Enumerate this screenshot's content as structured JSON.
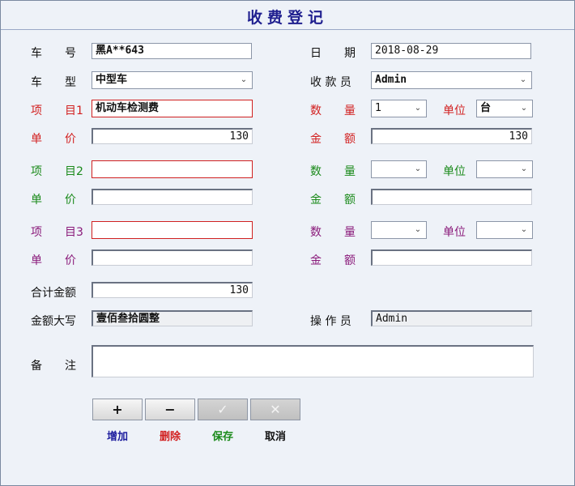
{
  "title": "收费登记",
  "labels": {
    "plate": "车　　号",
    "date": "日　　期",
    "vehicle_type": "车　　型",
    "cashier": "收 款 员",
    "item1": "项　　目1",
    "qty1": "数　　量",
    "unit1": "单位",
    "price1": "单　　价",
    "amount1": "金　　额",
    "item2": "项　　目2",
    "qty2": "数　　量",
    "unit2": "单位",
    "price2": "单　　价",
    "amount2": "金　　额",
    "item3": "项　　目3",
    "qty3": "数　　量",
    "unit3": "单位",
    "price3": "单　　价",
    "amount3": "金　　额",
    "total": "合计金额",
    "total_upper": "金额大写",
    "operator": "操 作 员",
    "remark": "备　　注"
  },
  "values": {
    "plate": "黑A**643",
    "date": "2018-08-29",
    "vehicle_type": "中型车",
    "cashier": "Admin",
    "item1": "机动车检测费",
    "qty1": "1",
    "unit1": "台",
    "price1": "130",
    "amount1": "130",
    "item2": "",
    "qty2": "",
    "unit2": "",
    "price2": "",
    "amount2": "",
    "item3": "",
    "qty3": "",
    "unit3": "",
    "price3": "",
    "amount3": "",
    "total": "130",
    "total_upper": "壹佰叁拾圆整",
    "operator": "Admin",
    "remark": ""
  },
  "buttons": {
    "add": {
      "icon": "+",
      "label": "增加"
    },
    "delete": {
      "icon": "−",
      "label": "删除"
    },
    "save": {
      "icon": "✓",
      "label": "保存"
    },
    "cancel": {
      "icon": "✕",
      "label": "取消"
    }
  },
  "colors": {
    "title": "#1f1f8f",
    "row_item1": "#d22020",
    "row_item2": "#1a8a1a",
    "row_item3": "#8a1a7a",
    "label_add": "#1f1f9f",
    "label_delete": "#d22020",
    "label_save": "#1a8a1a",
    "label_cancel": "#111111"
  },
  "icons": {
    "chevron": "chevron-down-icon"
  }
}
